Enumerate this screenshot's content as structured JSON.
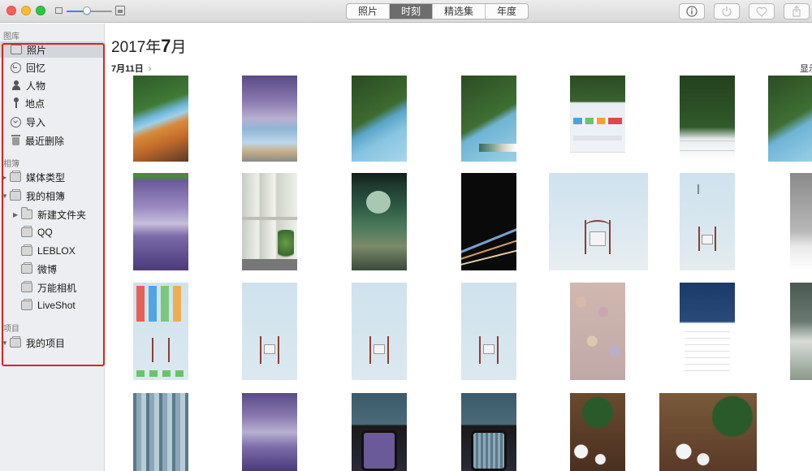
{
  "window": {
    "tabs": [
      {
        "label": "照片",
        "active": false
      },
      {
        "label": "时刻",
        "active": true
      },
      {
        "label": "精选集",
        "active": false
      },
      {
        "label": "年度",
        "active": false
      }
    ],
    "zoom_level": 0.45,
    "toolbar_icons": [
      "info-icon",
      "rotate-icon",
      "heart-icon",
      "share-icon"
    ]
  },
  "sidebar": {
    "library_header": "图库",
    "albums_header": "相簿",
    "projects_header": "项目",
    "library_items": [
      {
        "label": "照片",
        "icon": "photos-icon",
        "selected": true
      },
      {
        "label": "回忆",
        "icon": "memories-icon"
      },
      {
        "label": "人物",
        "icon": "people-icon"
      },
      {
        "label": "地点",
        "icon": "places-icon"
      },
      {
        "label": "导入",
        "icon": "import-icon"
      },
      {
        "label": "最近删除",
        "icon": "trash-icon"
      }
    ],
    "album_items": [
      {
        "label": "媒体类型",
        "icon": "album-icon",
        "disclosure": "▶"
      },
      {
        "label": "我的相簿",
        "icon": "album-icon",
        "disclosure": "▼"
      },
      {
        "label": "新建文件夹",
        "icon": "folder-icon",
        "disclosure": "▶"
      },
      {
        "label": "QQ",
        "icon": "album-icon"
      },
      {
        "label": "LEBLOX",
        "icon": "album-icon"
      },
      {
        "label": "微博",
        "icon": "album-icon"
      },
      {
        "label": "万能相机",
        "icon": "album-icon"
      },
      {
        "label": "LiveShot",
        "icon": "album-icon"
      }
    ],
    "project_items": [
      {
        "label": "我的项目",
        "icon": "album-icon",
        "disclosure": "▼"
      }
    ]
  },
  "main": {
    "month_year_prefix": "2017年",
    "month_number": "7",
    "month_suffix": "月",
    "date_label": "7月11日",
    "date_chevron": "›",
    "show_all": "显示"
  },
  "colors": {
    "accent": "#3b82f6",
    "highlight_border": "#e02020",
    "sidebar_bg": "#eceef1",
    "selected_tab": "#6d6d6d"
  }
}
